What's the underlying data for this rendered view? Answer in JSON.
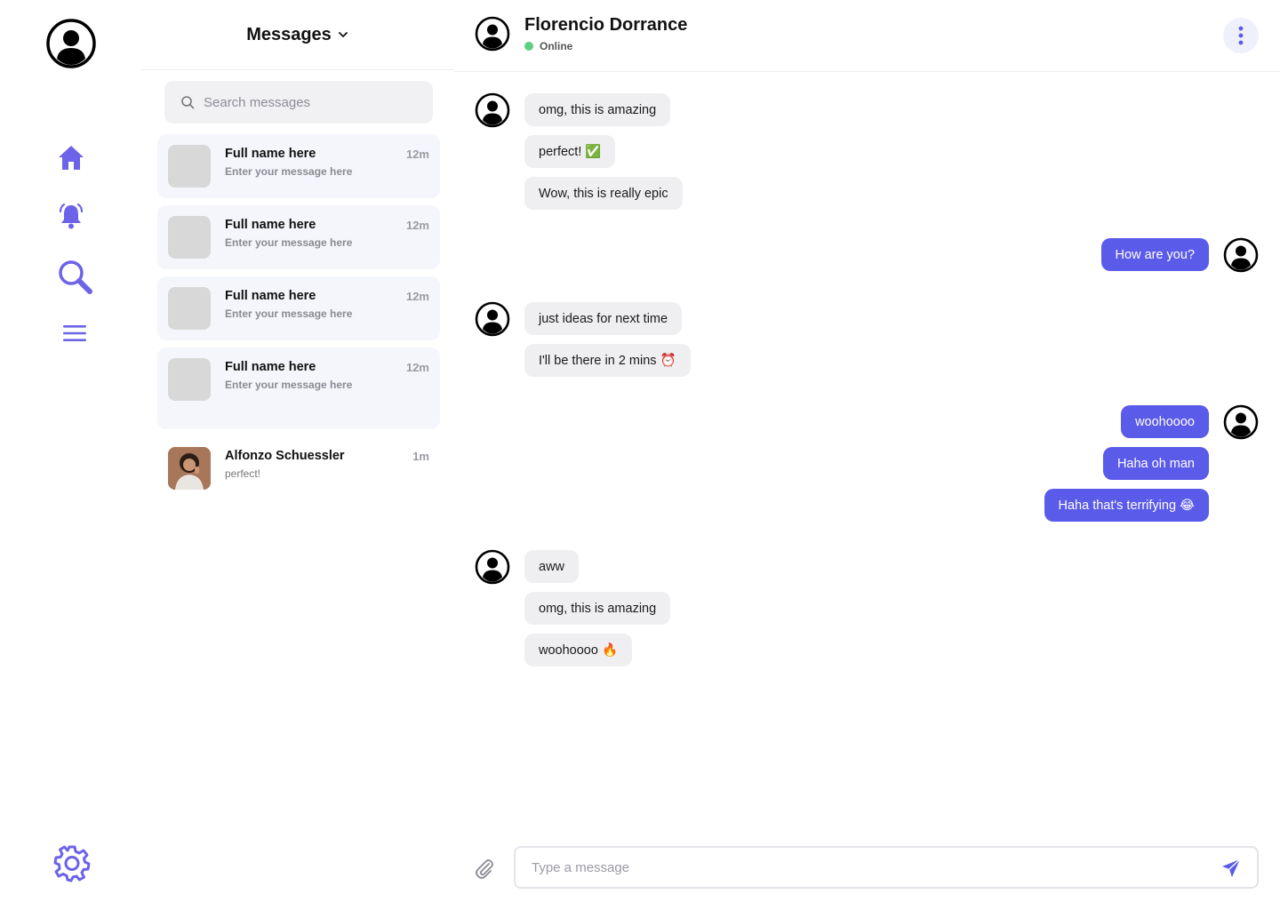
{
  "colors": {
    "accent": "#5b5bea",
    "nav_icon": "#6c63e8",
    "online": "#5fcf80",
    "incoming_bubble": "#efeff1",
    "outgoing_bubble": "#5b5bea"
  },
  "rail": {
    "icons": [
      "user-avatar-icon",
      "home-icon",
      "bell-ring-icon",
      "search-icon",
      "hamburger-menu-icon",
      "gear-icon"
    ]
  },
  "conversations": {
    "header_title": "Messages",
    "search_placeholder": "Search messages",
    "items": [
      {
        "name": "Full name here",
        "preview": "Enter your message here",
        "time": "12m"
      },
      {
        "name": "Full name here",
        "preview": "Enter your message here",
        "time": "12m"
      },
      {
        "name": "Full name here",
        "preview": "Enter your message here",
        "time": "12m"
      },
      {
        "name": "Full name here",
        "preview": "Enter your message here",
        "time": "12m"
      },
      {
        "name": "Alfonzo Schuessler",
        "preview": "perfect!",
        "time": "1m"
      }
    ]
  },
  "chat": {
    "contact_name": "Florencio Dorrance",
    "status": "Online",
    "composer_placeholder": "Type a message",
    "messages": [
      {
        "text": "omg, this is amazing",
        "direction": "in"
      },
      {
        "text": "perfect! ✅",
        "direction": "in"
      },
      {
        "text": "Wow, this is really epic",
        "direction": "in"
      },
      {
        "text": "How are you?",
        "direction": "out"
      },
      {
        "text": "just ideas for next time",
        "direction": "in"
      },
      {
        "text": "I'll be there in 2 mins ⏰",
        "direction": "in"
      },
      {
        "text": "woohoooo",
        "direction": "out"
      },
      {
        "text": "Haha oh man",
        "direction": "out"
      },
      {
        "text": "Haha that's terrifying 😂",
        "direction": "out"
      },
      {
        "text": "aww",
        "direction": "in"
      },
      {
        "text": "omg, this is amazing",
        "direction": "in"
      },
      {
        "text": "woohoooo 🔥",
        "direction": "in"
      }
    ]
  }
}
